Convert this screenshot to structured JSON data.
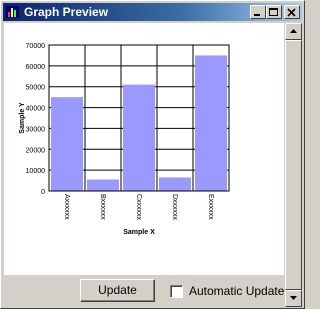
{
  "window": {
    "title": "Graph Preview",
    "icons": {
      "app": "bar-chart-icon",
      "minimize": "minimize-icon",
      "maximize": "maximize-icon",
      "close": "close-icon"
    }
  },
  "controls": {
    "update_label": "Update",
    "auto_update_label": "Automatic Update",
    "auto_update_checked": false
  },
  "colors": {
    "bar": "#9999ff",
    "titlebar_start": "#0a246a",
    "titlebar_end": "#a6caf0"
  },
  "chart_data": {
    "type": "bar",
    "xlabel": "Sample X",
    "ylabel": "Sample Y",
    "categories": [
      "Axxxxxx",
      "Bxxxxxx",
      "Cxxxxxx",
      "Dxxxxxx",
      "Exxxxxx"
    ],
    "values": [
      45000,
      5500,
      51000,
      6500,
      65000
    ],
    "ylim": [
      0,
      70000
    ],
    "yticks": [
      "0",
      "10000",
      "20000",
      "30000",
      "40000",
      "50000",
      "60000",
      "70000"
    ],
    "grid": true
  }
}
